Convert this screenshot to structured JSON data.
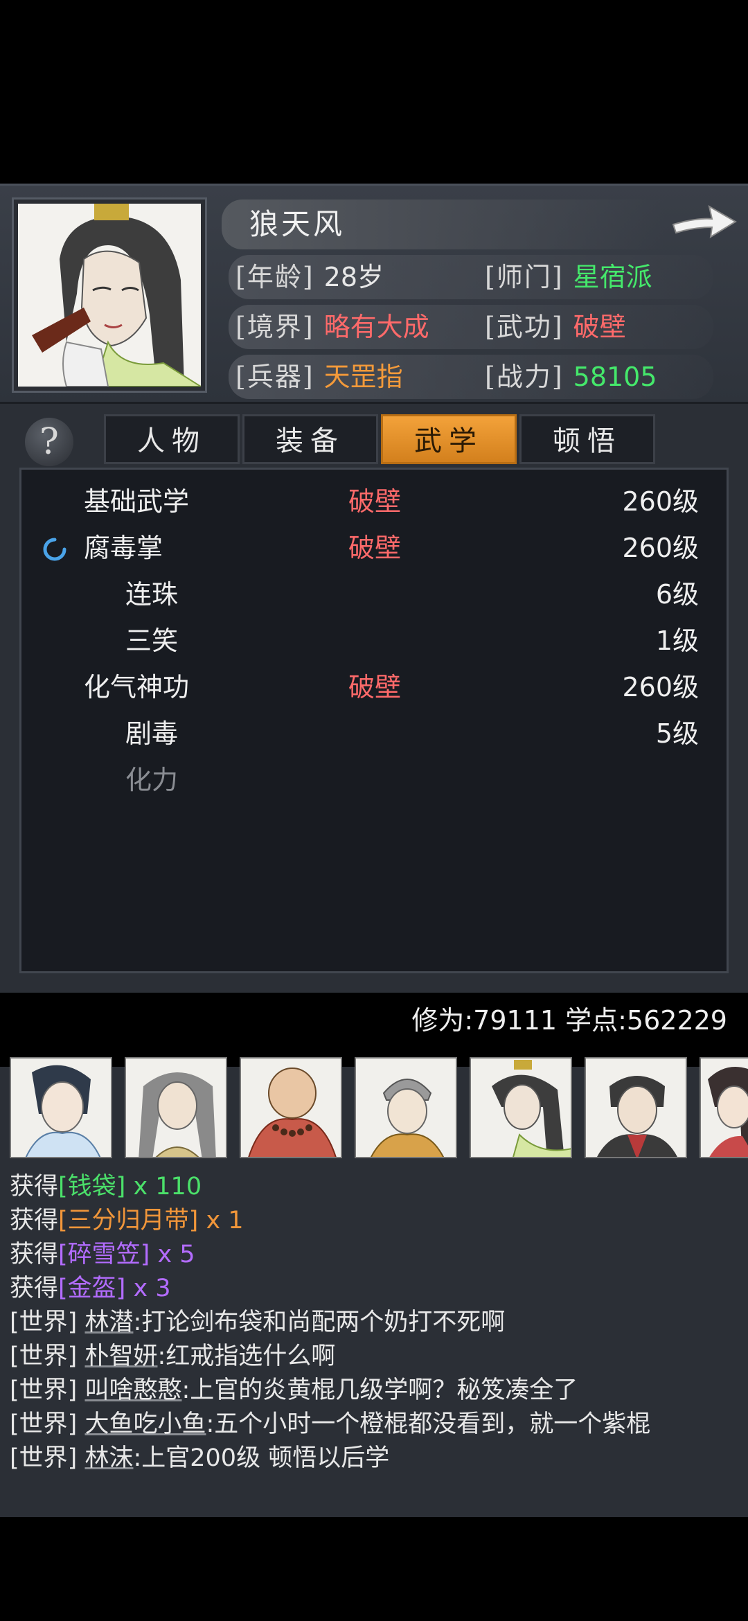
{
  "profile": {
    "name": "狼天风",
    "stats": [
      {
        "key": "[年龄]",
        "value": "28岁",
        "color": "#e8e8e8"
      },
      {
        "key": "[师门]",
        "value": "星宿派",
        "color": "#45e86b"
      },
      {
        "key": "[境界]",
        "value": "略有大成",
        "color": "#ff6a6a"
      },
      {
        "key": "[武功]",
        "value": "破壁",
        "color": "#ff6a6a"
      },
      {
        "key": "[兵器]",
        "value": "天罡指",
        "color": "#f39a3a"
      },
      {
        "key": "[战力]",
        "value": "58105",
        "color": "#45e86b"
      }
    ]
  },
  "tabs": [
    {
      "label": "人物",
      "active": false
    },
    {
      "label": "装备",
      "active": false
    },
    {
      "label": "武学",
      "active": true
    },
    {
      "label": "顿悟",
      "active": false
    }
  ],
  "skills": [
    {
      "name": "基础武学",
      "realm": "破壁",
      "grade": "260级",
      "indent": false,
      "loading": false,
      "dim": false
    },
    {
      "name": "腐毒掌",
      "realm": "破壁",
      "grade": "260级",
      "indent": false,
      "loading": true,
      "dim": false
    },
    {
      "name": "连珠",
      "realm": "",
      "grade": "6级",
      "indent": true,
      "loading": false,
      "dim": false
    },
    {
      "name": "三笑",
      "realm": "",
      "grade": "1级",
      "indent": true,
      "loading": false,
      "dim": false
    },
    {
      "name": "化气神功",
      "realm": "破壁",
      "grade": "260级",
      "indent": false,
      "loading": false,
      "dim": false
    },
    {
      "name": "剧毒",
      "realm": "",
      "grade": "5级",
      "indent": true,
      "loading": false,
      "dim": false
    },
    {
      "name": "化力",
      "realm": "",
      "grade": "",
      "indent": true,
      "loading": false,
      "dim": true
    }
  ],
  "points": {
    "text": "修为:79111 学点:562229"
  },
  "log": {
    "loot": [
      {
        "prefix": "获得",
        "item": "[钱袋]",
        "qty": " x 110",
        "color": "item-green"
      },
      {
        "prefix": "获得",
        "item": "[三分归月带]",
        "qty": " x 1",
        "color": "item-orange"
      },
      {
        "prefix": "获得",
        "item": "[碎雪笠]",
        "qty": " x 5",
        "color": "item-purple"
      },
      {
        "prefix": "获得",
        "item": "[金盔]",
        "qty": " x 3",
        "color": "item-purple"
      }
    ],
    "chat": [
      {
        "tag": "[世界]",
        "user": "林潜",
        "msg": ":打论剑布袋和尚配两个奶打不死啊"
      },
      {
        "tag": "[世界]",
        "user": "朴智妍",
        "msg": ":红戒指选什么啊"
      },
      {
        "tag": "[世界]",
        "user": "叫啥憨憨",
        "msg": ":上官的炎黄棍几级学啊？秘笈凑全了"
      },
      {
        "tag": "[世界]",
        "user": "大鱼吃小鱼",
        "msg": ":五个小时一个橙棍都没看到，就一个紫棍"
      },
      {
        "tag": "[世界]",
        "user": "林沫",
        "msg": ":上官200级 顿悟以后学"
      }
    ]
  }
}
